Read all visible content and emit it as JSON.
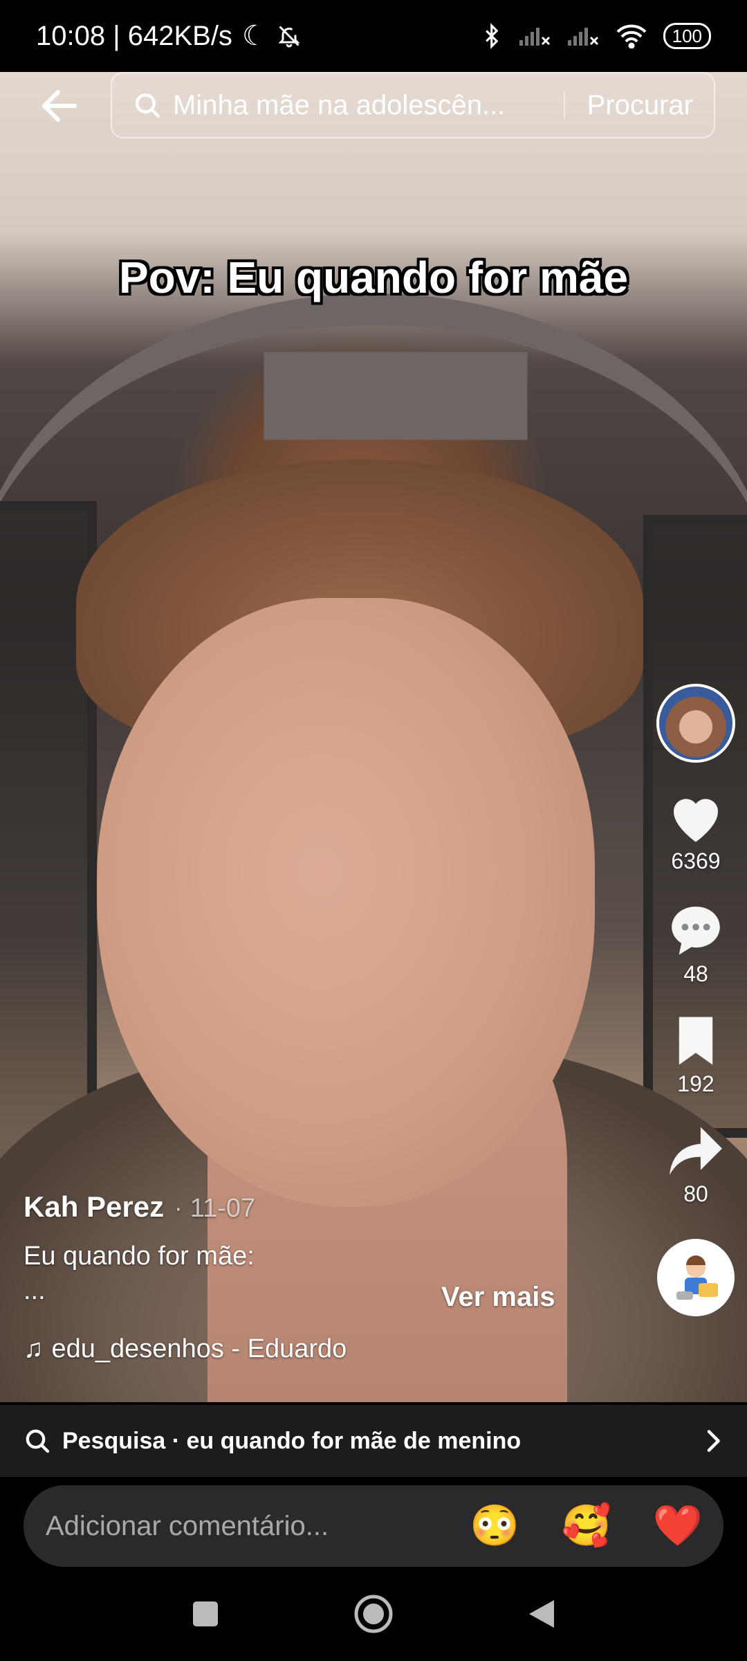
{
  "status_bar": {
    "time_speed": "10:08 | 642KB/s",
    "battery": "100"
  },
  "search": {
    "query": "Minha mãe na adolescên...",
    "button": "Procurar"
  },
  "video": {
    "caption": "Pov: Eu quando for mãe"
  },
  "actions": {
    "likes": "6369",
    "comments": "48",
    "saves": "192",
    "shares": "80"
  },
  "post": {
    "author": "Kah Perez",
    "date": "· 11-07",
    "description": "Eu quando for mãe:",
    "description_more": "...",
    "see_more": "Ver mais",
    "sound": "edu_desenhos - Eduardo"
  },
  "related_search": {
    "text": "Pesquisa · eu quando for mãe de menino"
  },
  "comment_bar": {
    "placeholder": "Adicionar comentário...",
    "emojis": [
      "😳",
      "🥰",
      "❤️"
    ]
  },
  "colors": {
    "background": "#000000",
    "panel": "#1c1c1e",
    "input": "#2a2a2c"
  }
}
